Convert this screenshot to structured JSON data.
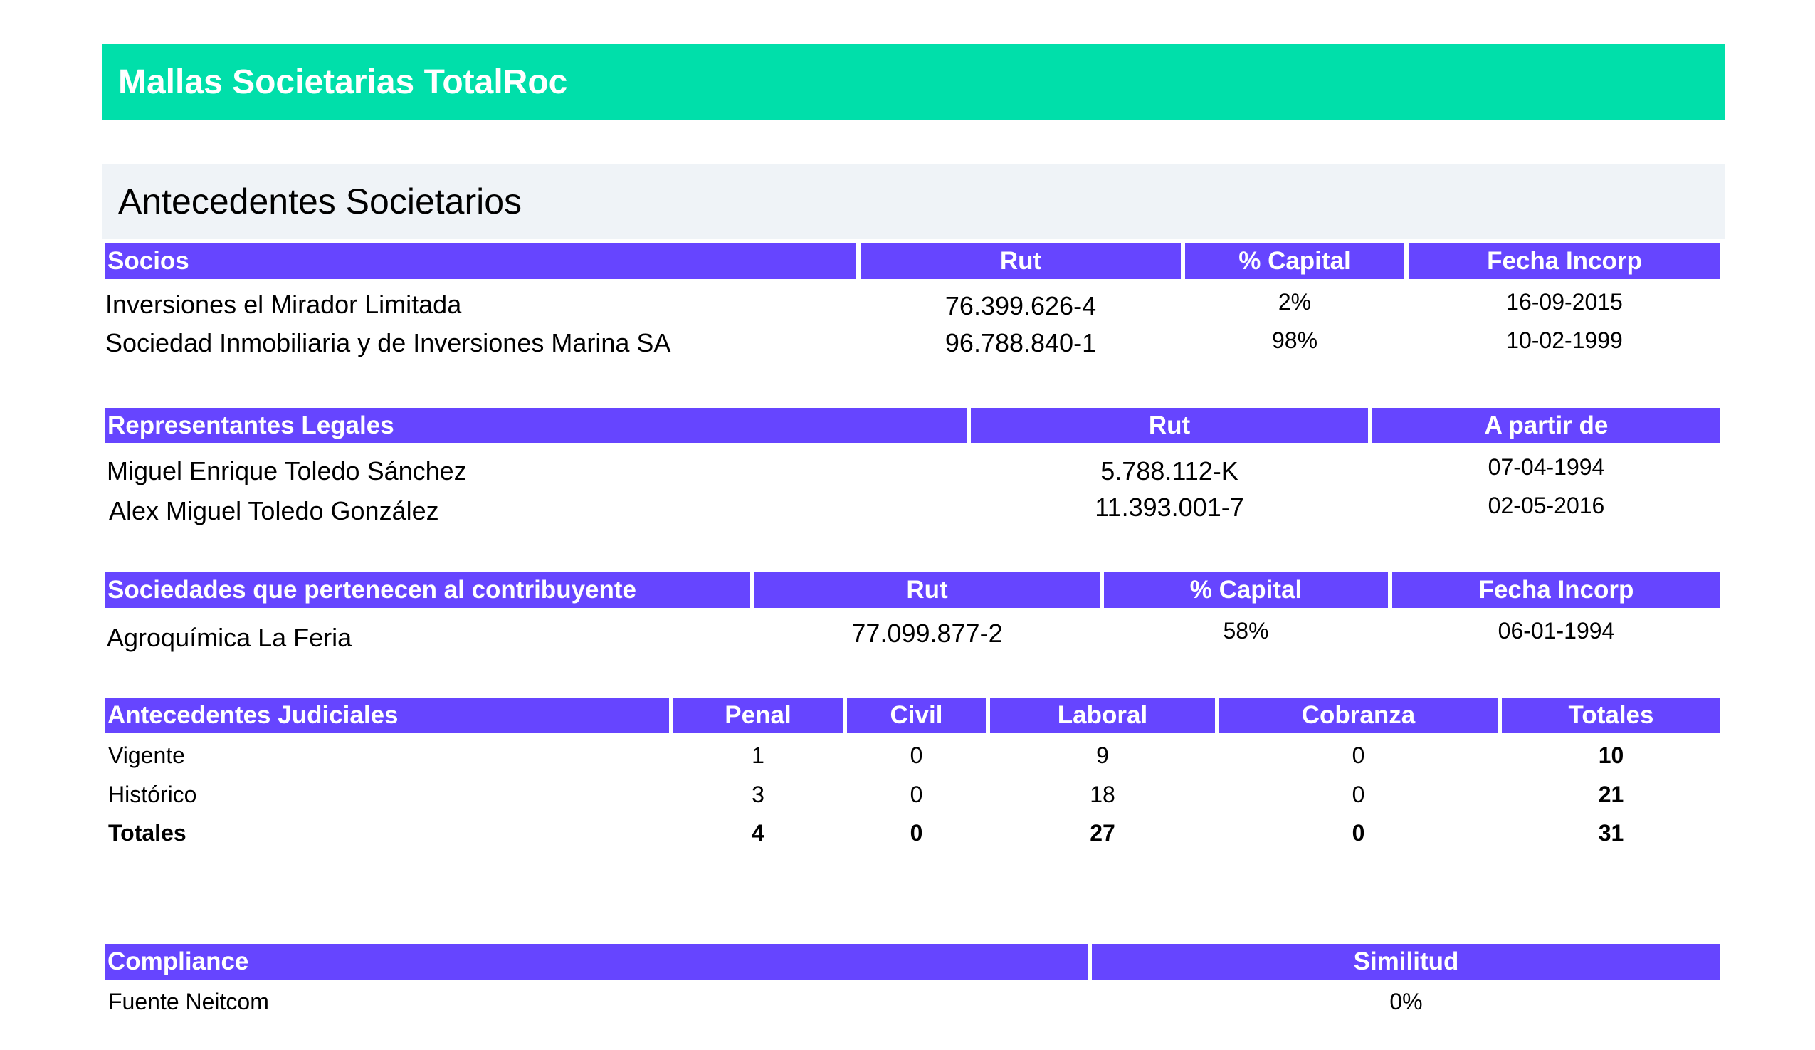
{
  "header": {
    "title": "Mallas Societarias TotalRoc"
  },
  "section": {
    "title": "Antecedentes Societarios"
  },
  "socios": {
    "headers": [
      "Socios",
      "Rut",
      "% Capital",
      "Fecha Incorp"
    ],
    "rows": [
      [
        "Inversiones el Mirador Limitada",
        "76.399.626-4",
        "2%",
        "16-09-2015"
      ],
      [
        "Sociedad Inmobiliaria y de Inversiones Marina SA",
        "96.788.840-1",
        "98%",
        "10-02-1999"
      ]
    ]
  },
  "representantes": {
    "headers": [
      "Representantes Legales",
      "Rut",
      "A partir de"
    ],
    "rows": [
      [
        "Miguel Enrique Toledo Sánchez",
        "5.788.112-K",
        "07-04-1994"
      ],
      [
        "Alex Miguel Toledo González",
        "11.393.001-7",
        "02-05-2016"
      ]
    ]
  },
  "sociedades": {
    "headers": [
      "Sociedades que pertenecen al contribuyente",
      "Rut",
      "% Capital",
      "Fecha Incorp"
    ],
    "rows": [
      [
        "Agroquímica La Feria",
        "77.099.877-2",
        "58%",
        "06-01-1994"
      ]
    ]
  },
  "judiciales": {
    "headers": [
      "Antecedentes Judiciales",
      "Penal",
      "Civil",
      "Laboral",
      "Cobranza",
      "Totales"
    ],
    "rows": [
      [
        "Vigente",
        "1",
        "0",
        "9",
        "0",
        "10"
      ],
      [
        "Histórico",
        "3",
        "0",
        "18",
        "0",
        "21"
      ],
      [
        "Totales",
        "4",
        "0",
        "27",
        "0",
        "31"
      ]
    ]
  },
  "compliance": {
    "headers": [
      "Compliance",
      "Similitud"
    ],
    "rows": [
      [
        "Fuente Neitcom",
        "0%"
      ]
    ]
  }
}
